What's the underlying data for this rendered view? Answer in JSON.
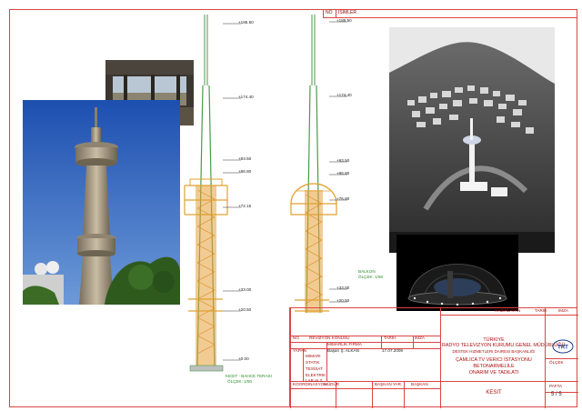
{
  "header": {
    "no_label": "NO",
    "no_value": "ISIMLER"
  },
  "elevations_left": [
    "+185.50",
    "+174.40",
    "+93.50",
    "+86.80",
    "+72.15",
    "+33.00",
    "+20.50",
    "+0.00"
  ],
  "elevations_right": [
    "+185.50",
    "+174.40",
    "+93.50",
    "+86.80",
    "+76.80",
    "+33.00",
    "+20.50"
  ],
  "markers": {
    "left_bottom": "KESIT - BAHCE TERASI",
    "left_bottom_sub": "ÖLÇEK: 1/50",
    "right_mid": "BALKON",
    "right_mid_sub": "ÖLÇEK: 1/50"
  },
  "title_block": {
    "revision_no": "NO",
    "revision_label": "REVIZYON KONUSU",
    "arch_sub": "MIMARI",
    "arch_firm": "MIMARLIK FIRMA",
    "date_label": "TARIH",
    "sign_label": "IMZA",
    "prepared_label": "HAZIRLAYAN",
    "prepared_date": "TARIH",
    "prepared_sign": "IMZA",
    "made_by": "YAPAN",
    "made_by_name": "Başarı Ş. ALKAN",
    "made_date": "17.07.2009",
    "disciplines": [
      "MIMARI",
      "STATIK",
      "TESISAT",
      "ELEKTRIK",
      "LAB.ALZ"
    ],
    "coordination": "KOORDINASYON",
    "manager": "MÜDÜR",
    "chief_deputy": "BAŞKAN YAR.",
    "chief": "BAŞKAN",
    "country": "TÜRKIYE",
    "org_line1": "RADYO TELEVIZYON KURUMU GENEL MÜDÜRLÜĞÜ",
    "org_line2": "DESTEK HIZMETLERI DAIRESI BAŞKANLIĞI",
    "project_line1": "ÇAMLICA TV VERICI İSTASYONU",
    "project_line2": "BETONARMELİLE",
    "project_line3": "ONARIM VE TADILATI",
    "sheet_title": "KESIT",
    "scale_label": "ÖLÇEK",
    "sheet_label": "PAFTA",
    "sheet_no": "5 / 5",
    "logo_text": "TRT"
  }
}
